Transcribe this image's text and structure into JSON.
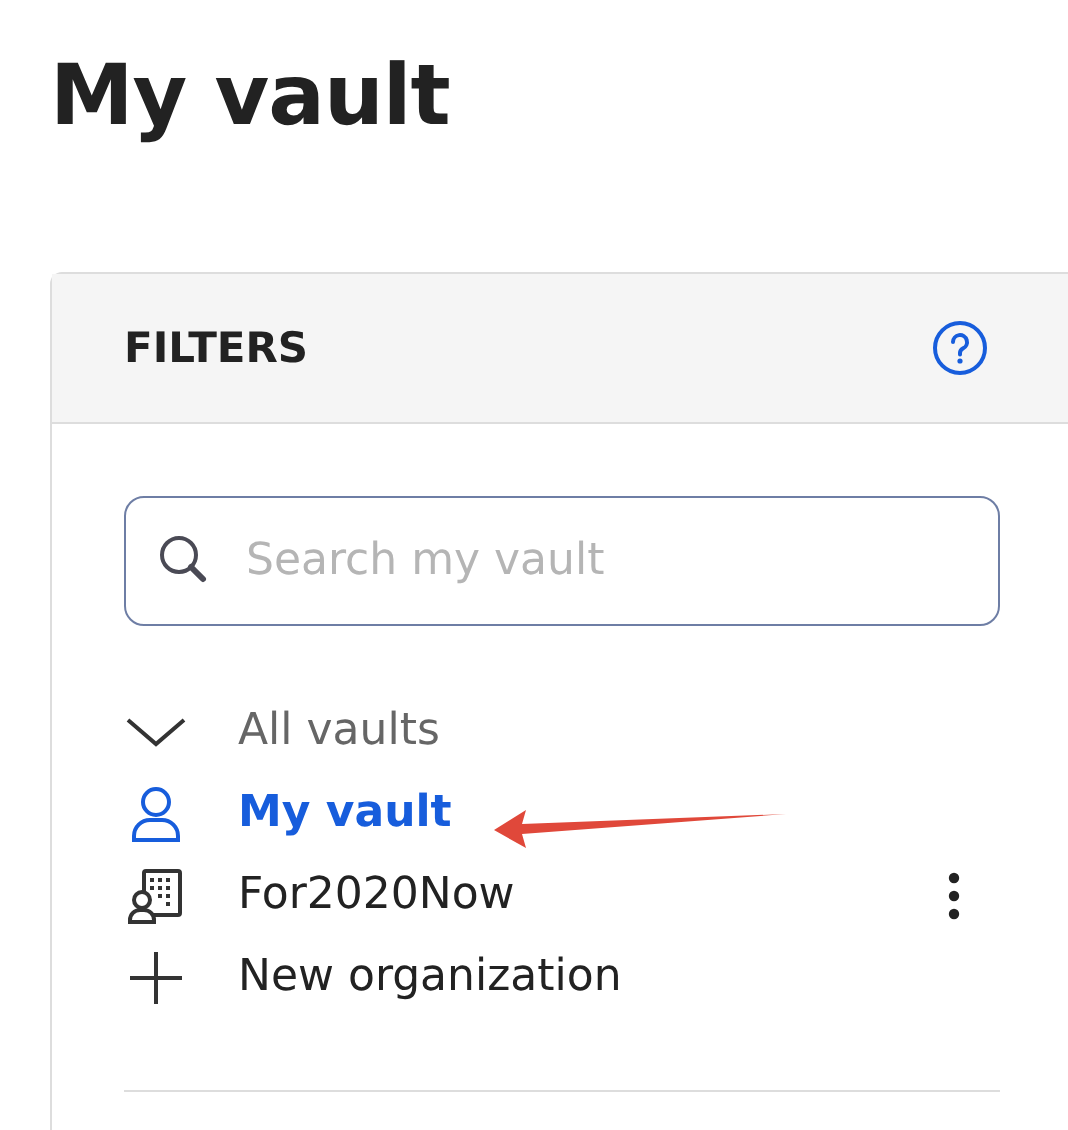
{
  "page": {
    "title": "My vault"
  },
  "filters": {
    "title": "FILTERS",
    "search": {
      "placeholder": "Search my vault"
    },
    "vaults": {
      "label": "All vaults",
      "expanded": true,
      "children": [
        {
          "kind": "person",
          "label": "My vault",
          "selected": true,
          "has_menu": false
        },
        {
          "kind": "organization",
          "label": "For2020Now",
          "selected": false,
          "has_menu": true
        },
        {
          "kind": "add",
          "label": "New organization",
          "selected": false,
          "has_menu": false
        }
      ]
    }
  }
}
